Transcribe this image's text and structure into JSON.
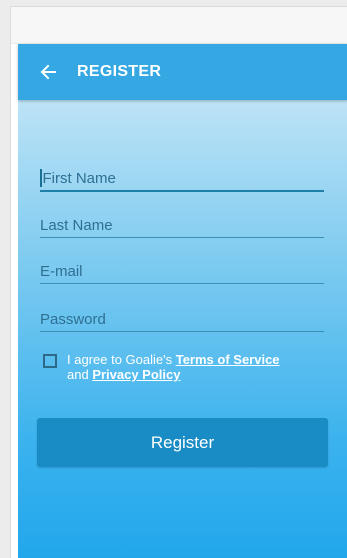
{
  "app_bar": {
    "title": "REGISTER",
    "back_icon": "arrow-left-icon",
    "color": "#35a8e4"
  },
  "form": {
    "first_name": {
      "placeholder": "First Name",
      "value": ""
    },
    "last_name": {
      "placeholder": "Last Name",
      "value": ""
    },
    "email": {
      "placeholder": "E-mail",
      "value": ""
    },
    "password": {
      "placeholder": "Password",
      "value": ""
    },
    "agree": {
      "checked": false,
      "prefix": "I agree to Goalie's ",
      "terms_label": "Terms of Service",
      "middle": "and ",
      "privacy_label": "Privacy Policy"
    },
    "submit_label": "Register"
  },
  "colors": {
    "button": "#1a8cc5",
    "gradient_top": "#bde3f6",
    "gradient_bottom": "#22a7ec"
  }
}
